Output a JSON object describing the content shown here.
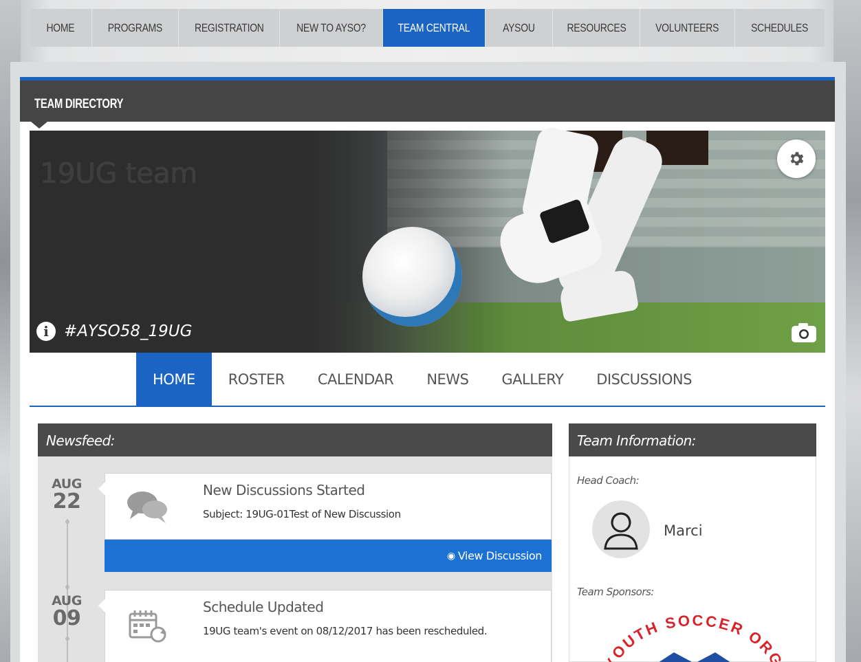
{
  "top_nav": {
    "items": [
      {
        "label": "HOME"
      },
      {
        "label": "PROGRAMS"
      },
      {
        "label": "REGISTRATION"
      },
      {
        "label": "NEW TO AYSO?"
      },
      {
        "label": "TEAM CENTRAL",
        "active": true
      },
      {
        "label": "AYSOU"
      },
      {
        "label": "RESOURCES"
      },
      {
        "label": "VOLUNTEERS"
      },
      {
        "label": "SCHEDULES"
      }
    ]
  },
  "section": {
    "title": "TEAM DIRECTORY"
  },
  "banner": {
    "team_name": "19UG team",
    "hashtag": "#AYSO58_19UG",
    "icons": {
      "info": "info-icon",
      "settings": "gear-icon",
      "photo": "camera-icon"
    }
  },
  "tabs": [
    {
      "label": "HOME",
      "active": true
    },
    {
      "label": "ROSTER"
    },
    {
      "label": "CALENDAR"
    },
    {
      "label": "NEWS"
    },
    {
      "label": "GALLERY"
    },
    {
      "label": "DISCUSSIONS"
    }
  ],
  "newsfeed": {
    "header": "Newsfeed:",
    "items": [
      {
        "month": "AUG",
        "day": "22",
        "icon": "chat-bubbles-icon",
        "title": "New Discussions Started",
        "text": "Subject: 19UG-01Test of New Discussion",
        "action": "View Discussion"
      },
      {
        "month": "AUG",
        "day": "09",
        "icon": "calendar-refresh-icon",
        "title": "Schedule Updated",
        "text": "19UG team's event on 08/12/2017 has been rescheduled."
      }
    ]
  },
  "team_info": {
    "header": "Team Information:",
    "head_coach_label": "Head Coach:",
    "head_coach_name": "Marci",
    "sponsors_label": "Team Sponsors:",
    "sponsor_logo_text": "YOUTH SOCCER ORG"
  },
  "colors": {
    "accent": "#1c64c4",
    "dark_bar": "#454545",
    "nav_bg": "#cfd0d2"
  }
}
